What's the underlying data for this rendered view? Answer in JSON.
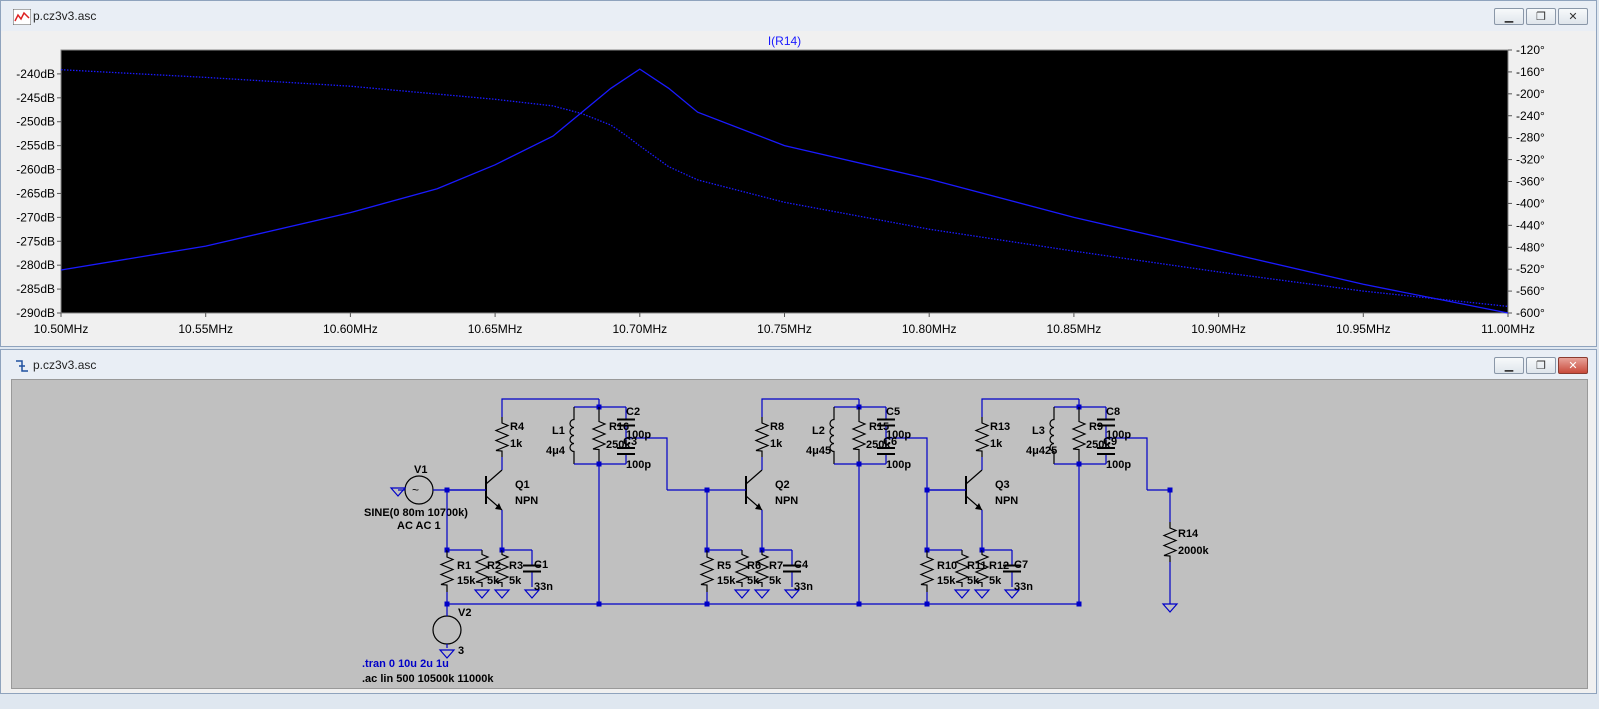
{
  "plot_window": {
    "title": "p.cz3v3.asc",
    "buttons": {
      "minimize": "▁",
      "restore": "❐",
      "close": "✕"
    }
  },
  "schematic_window": {
    "title": "p.cz3v3.asc",
    "buttons": {
      "minimize": "▁",
      "restore": "❐",
      "close": "✕"
    }
  },
  "colors": {
    "trace": "#1a1aff",
    "plot_bg": "#000000",
    "axis_text": "#000000",
    "schematic_bg": "#c0c0c0",
    "wire": "#0000c8"
  },
  "chart_data": {
    "type": "line",
    "title": "I(R14)",
    "x_unit": "MHz",
    "x_ticks": [
      "10.50MHz",
      "10.55MHz",
      "10.60MHz",
      "10.65MHz",
      "10.70MHz",
      "10.75MHz",
      "10.80MHz",
      "10.85MHz",
      "10.90MHz",
      "10.95MHz",
      "11.00MHz"
    ],
    "y_left_ticks": [
      "-240dB",
      "-245dB",
      "-250dB",
      "-255dB",
      "-260dB",
      "-265dB",
      "-270dB",
      "-275dB",
      "-280dB",
      "-285dB",
      "-290dB"
    ],
    "y_right_ticks": [
      "-120°",
      "-160°",
      "-200°",
      "-240°",
      "-280°",
      "-320°",
      "-360°",
      "-400°",
      "-440°",
      "-480°",
      "-520°",
      "-560°",
      "-600°"
    ],
    "xlim": [
      10.5,
      11.0
    ],
    "ylim_left": [
      -290,
      -235
    ],
    "ylim_right": [
      -600,
      -120
    ],
    "series": [
      {
        "name": "I(R14)",
        "axis": "magnitude",
        "style": "solid",
        "x": [
          10.5,
          10.55,
          10.6,
          10.63,
          10.65,
          10.67,
          10.68,
          10.69,
          10.7,
          10.71,
          10.72,
          10.75,
          10.8,
          10.85,
          10.9,
          10.95,
          11.0
        ],
        "y": [
          -281,
          -276,
          -269,
          -264,
          -259,
          -253,
          -248,
          -243,
          -239,
          -243,
          -248,
          -255,
          -262,
          -270,
          -277,
          -284,
          -290
        ]
      },
      {
        "name": "I(R14) phase",
        "axis": "phase",
        "style": "dotted",
        "x": [
          10.5,
          10.55,
          10.6,
          10.65,
          10.67,
          10.68,
          10.69,
          10.695,
          10.7,
          10.71,
          10.72,
          10.75,
          10.8,
          10.85,
          10.9,
          10.95,
          11.0
        ],
        "y": [
          -156,
          -170,
          -186,
          -210,
          -222,
          -236,
          -257,
          -275,
          -295,
          -333,
          -357,
          -398,
          -447,
          -487,
          -525,
          -560,
          -588
        ]
      }
    ]
  },
  "schematic": {
    "labels": {
      "V1": "V1",
      "V1_val": "SINE(0 80m 10700k)",
      "V1_ac": "AC AC 1",
      "V2": "V2",
      "V2_val": "3",
      "Q1": "Q1",
      "Q2": "Q2",
      "Q3": "Q3",
      "npn": "NPN",
      "R1": "R1",
      "R1v": "15k",
      "R2": "R2",
      "R2v": "5k",
      "R3": "R3",
      "R3v": "5k",
      "R4": "R4",
      "R4v": "1k",
      "C1": "C1",
      "C1v": "33n",
      "L1": "L1",
      "L1v": "4μ4",
      "R16": "R16",
      "R16v": "250k",
      "C2": "C2",
      "C2v": "100p",
      "C3": "C3",
      "C3v": "100p",
      "R5": "R5",
      "R5v": "15k",
      "R6": "R6",
      "R6v": "5k",
      "R7": "R7",
      "R7v": "5k",
      "R8": "R8",
      "R8v": "1k",
      "C4": "C4",
      "C4v": "33n",
      "L2": "L2",
      "L2v": "4μ45",
      "R15": "R15",
      "R15v": "250k",
      "C5": "C5",
      "C5v": "100p",
      "C6": "C6",
      "C6v": "100p",
      "R10": "R10",
      "R10v": "15k",
      "R11": "R11",
      "R11v": "5k",
      "R12": "R12",
      "R12v": "5k",
      "R13": "R13",
      "R13v": "1k",
      "C7": "C7",
      "C7v": "33n",
      "L3": "L3",
      "L3v": "4μ425",
      "R9": "R9",
      "R9v": "250k",
      "C8": "C8",
      "C8v": "100p",
      "C9": "C9",
      "C9v": "100p",
      "R14": "R14",
      "R14v": "2000k",
      "tran": ".tran 0 10u 2u 1u",
      "ac": ".ac lin 500 10500k 11000k"
    }
  }
}
